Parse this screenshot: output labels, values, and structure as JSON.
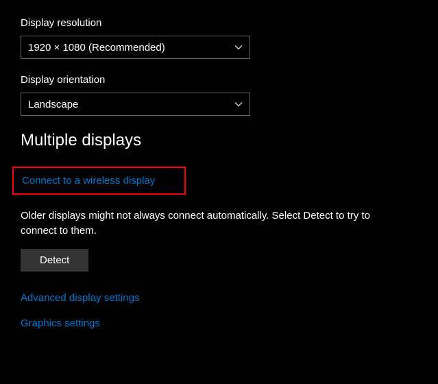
{
  "resolution": {
    "label": "Display resolution",
    "value": "1920 × 1080 (Recommended)"
  },
  "orientation": {
    "label": "Display orientation",
    "value": "Landscape"
  },
  "multiple_displays": {
    "heading": "Multiple displays",
    "connect_link": "Connect to a wireless display",
    "detect_text": "Older displays might not always connect automatically. Select Detect to try to connect to them.",
    "detect_button": "Detect"
  },
  "links": {
    "advanced": "Advanced display settings",
    "graphics": "Graphics settings"
  }
}
